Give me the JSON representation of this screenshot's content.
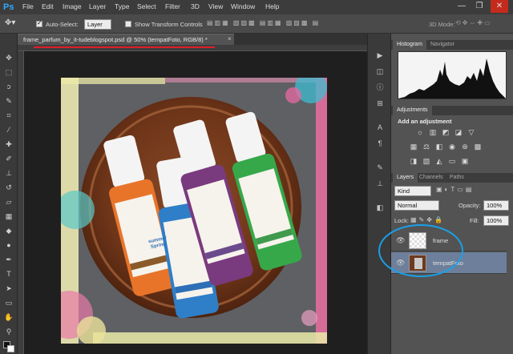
{
  "app": {
    "logo": "Ps"
  },
  "menu": [
    "File",
    "Edit",
    "Image",
    "Layer",
    "Type",
    "Select",
    "Filter",
    "3D",
    "View",
    "Window",
    "Help"
  ],
  "window_controls": {
    "minimize": "—",
    "restore": "❐",
    "close": "✕"
  },
  "options_bar": {
    "auto_select_label": "Auto-Select:",
    "auto_select_value": "Layer",
    "show_transform_label": "Show Transform Controls",
    "mode_label": "3D Mode:"
  },
  "document": {
    "tab_title": "frame_parfum_by_it-tudeblogspot.psd @ 50% (tempatFoto, RGB/8) *",
    "close": "×"
  },
  "histogram_panel": {
    "tabs": [
      "Histogram",
      "Navigator"
    ]
  },
  "adjustments_panel": {
    "tab": "Adjustments",
    "heading": "Add an adjustment"
  },
  "layers_panel": {
    "tabs": [
      "Layers",
      "Channels",
      "Paths"
    ],
    "kind_filter": "Kind",
    "blend_mode": "Normal",
    "opacity_label": "Opacity:",
    "opacity_value": "100%",
    "lock_label": "Lock:",
    "fill_label": "Fill:",
    "fill_value": "100%",
    "layers": [
      {
        "name": "frame",
        "visible": true,
        "selected": false
      },
      {
        "name": "tempatFoto",
        "visible": true,
        "selected": true
      }
    ]
  },
  "artwork": {
    "bottle_brand_1": "summer",
    "bottle_brand_2": "Spring"
  },
  "colors": {
    "accent_blue": "#31a8ff",
    "selected_layer": "#6d7f9a",
    "annotation_circle": "#1aa0e6",
    "annotation_underline": "#e01e2a"
  }
}
